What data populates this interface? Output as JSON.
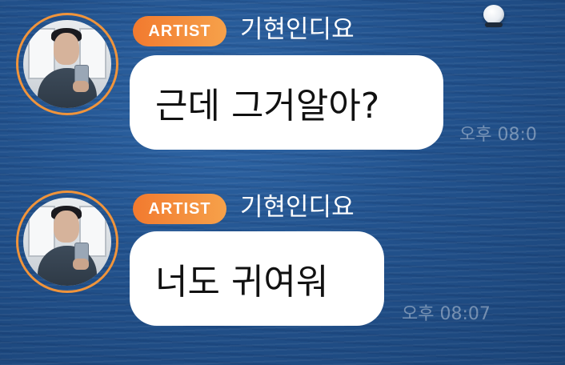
{
  "messages": [
    {
      "badge": "ARTIST",
      "sender": "기현인디요",
      "text": "근데 그거알아?",
      "time": "오후 08:0"
    },
    {
      "badge": "ARTIST",
      "sender": "기현인디요",
      "text": "너도 귀여워",
      "time": "오후 08:07"
    }
  ],
  "colors": {
    "badge_start": "#f27a2f",
    "badge_end": "#f6a14a",
    "avatar_ring": "#f0943b",
    "bubble": "#ffffff",
    "background_water": "#22528d"
  },
  "icons": [
    "buoy-image",
    "profile-avatar"
  ]
}
